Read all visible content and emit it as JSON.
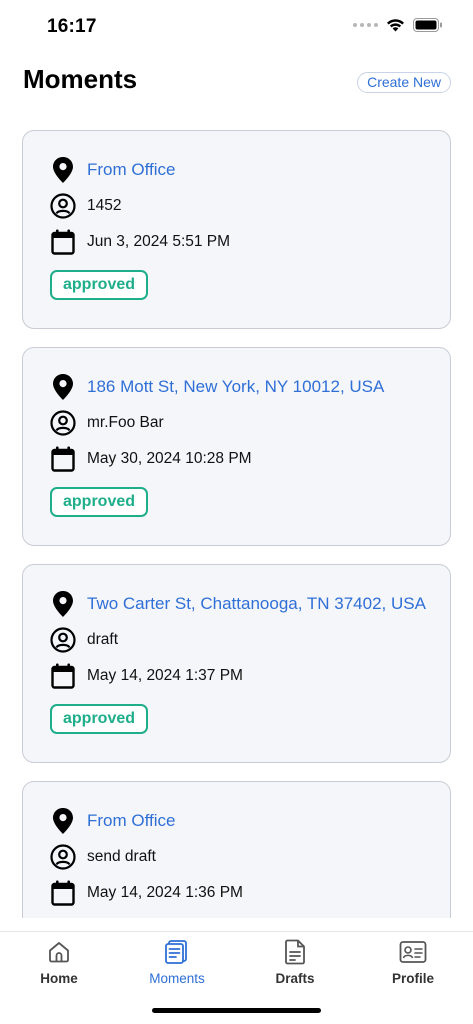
{
  "status_bar": {
    "time": "16:17"
  },
  "header": {
    "title": "Moments",
    "create_label": "Create New"
  },
  "moments": [
    {
      "location": "From Office",
      "user": "1452",
      "date": "Jun 3, 2024 5:51 PM",
      "status": "approved"
    },
    {
      "location": "186 Mott St, New York, NY 10012, USA",
      "user": "mr.Foo Bar",
      "date": "May 30, 2024 10:28 PM",
      "status": "approved"
    },
    {
      "location": "Two Carter St, Chattanooga, TN 37402, USA",
      "user": "draft",
      "date": "May 14, 2024 1:37 PM",
      "status": "approved"
    },
    {
      "location": "From Office",
      "user": "send draft",
      "date": "May 14, 2024 1:36 PM",
      "status": ""
    }
  ],
  "tabs": [
    {
      "label": "Home",
      "icon": "home-icon"
    },
    {
      "label": "Moments",
      "icon": "moments-icon"
    },
    {
      "label": "Drafts",
      "icon": "drafts-icon"
    },
    {
      "label": "Profile",
      "icon": "profile-card-icon"
    }
  ],
  "active_tab": "Moments",
  "colors": {
    "accent": "#2f6fd6",
    "approved": "#1fae8a",
    "card_bg": "#f5f6fa",
    "card_border": "#c9ccd6"
  }
}
